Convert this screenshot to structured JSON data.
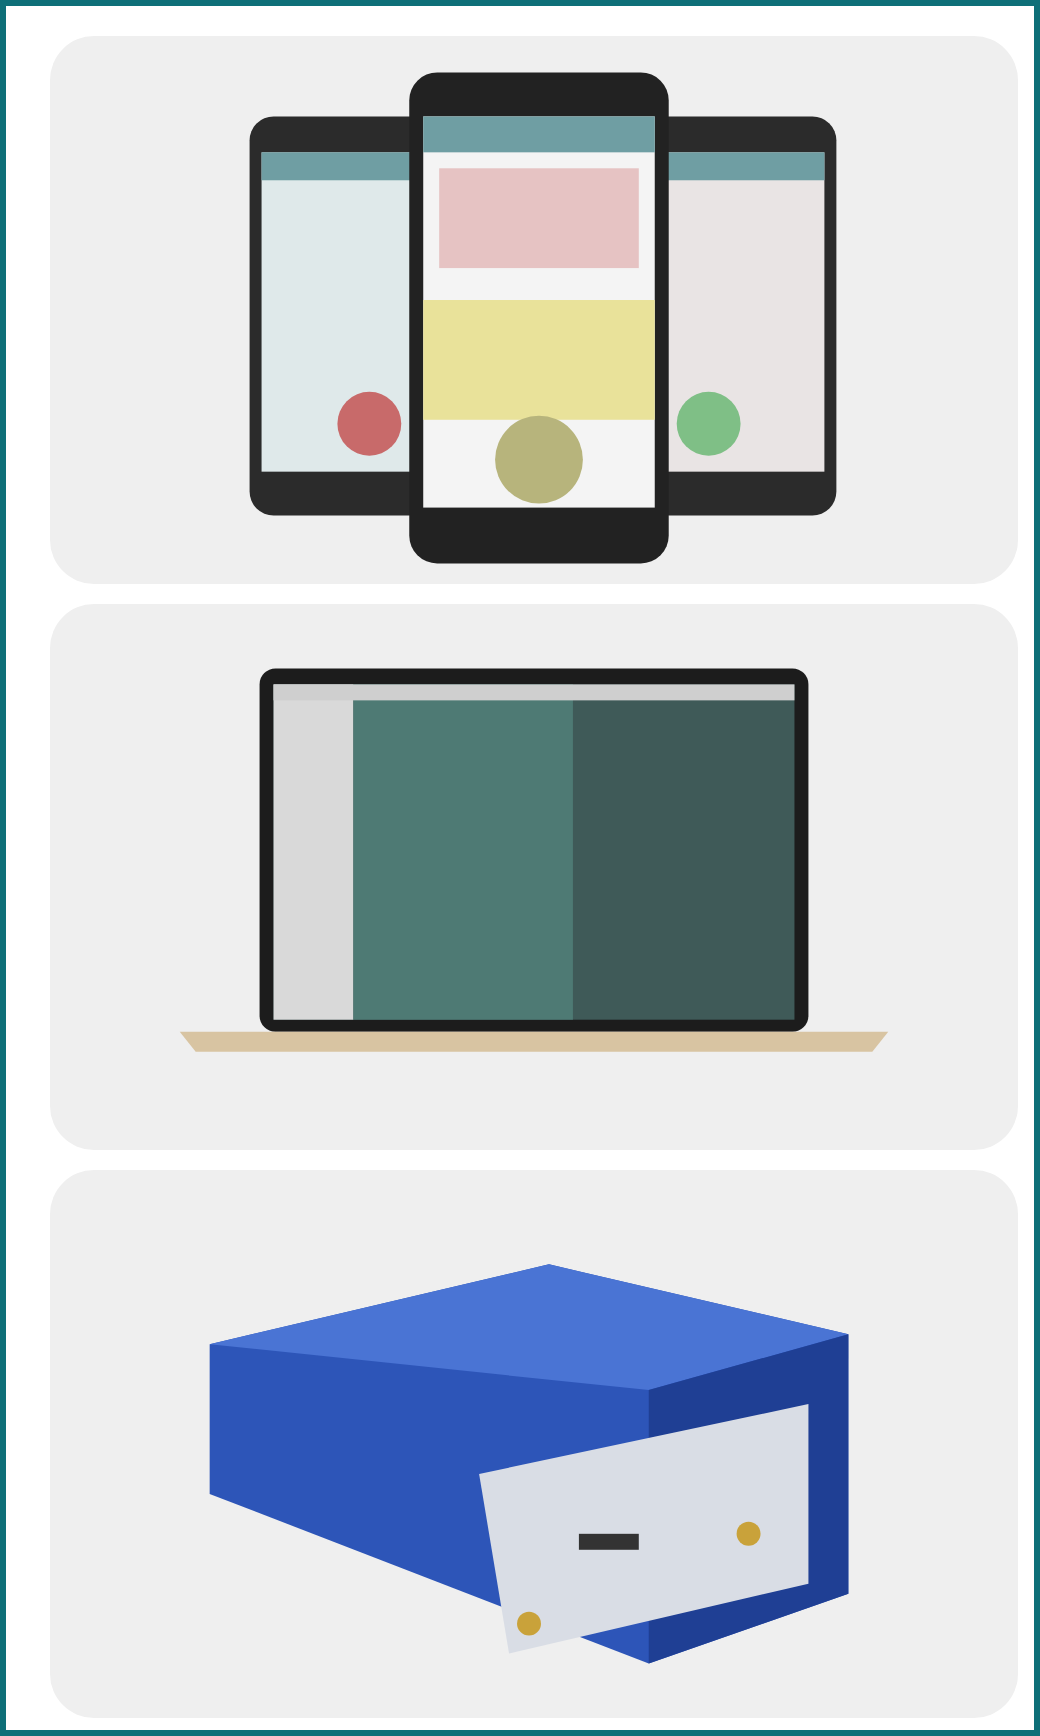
{
  "cards": [
    {
      "kind": "phones"
    },
    {
      "kind": "laptop"
    },
    {
      "kind": "device"
    }
  ]
}
